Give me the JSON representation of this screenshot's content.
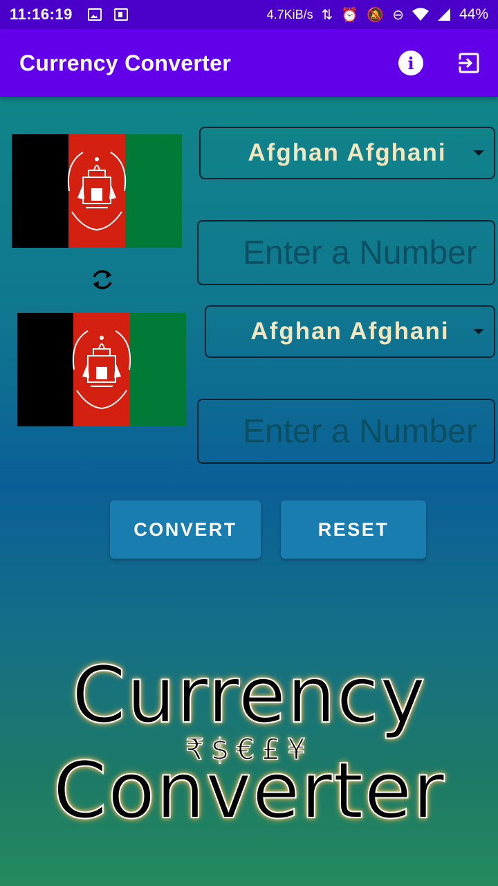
{
  "status_bar": {
    "time": "11:16:19",
    "speed": "4.7KiB/s",
    "battery": "44%"
  },
  "app_bar": {
    "title": "Currency Converter",
    "info_icon": "info-icon",
    "exit_icon": "exit-icon"
  },
  "from": {
    "currency": "Afghan Afghani",
    "flag": "afghanistan-flag",
    "amount_placeholder": "Enter a Number",
    "amount_value": ""
  },
  "to": {
    "currency": "Afghan Afghani",
    "flag": "afghanistan-flag",
    "amount_placeholder": "Enter a Number",
    "amount_value": ""
  },
  "swap_icon": "swap-icon",
  "buttons": {
    "convert": "CONVERT",
    "reset": "RESET"
  },
  "logo": {
    "line1": "Currency",
    "symbols": "₹$€£¥",
    "line2": "Converter"
  },
  "colors": {
    "status_bar": "#4a00c8",
    "app_bar": "#6200ea",
    "button": "#1a7db0",
    "dropdown_text": "#f0e6c0"
  }
}
